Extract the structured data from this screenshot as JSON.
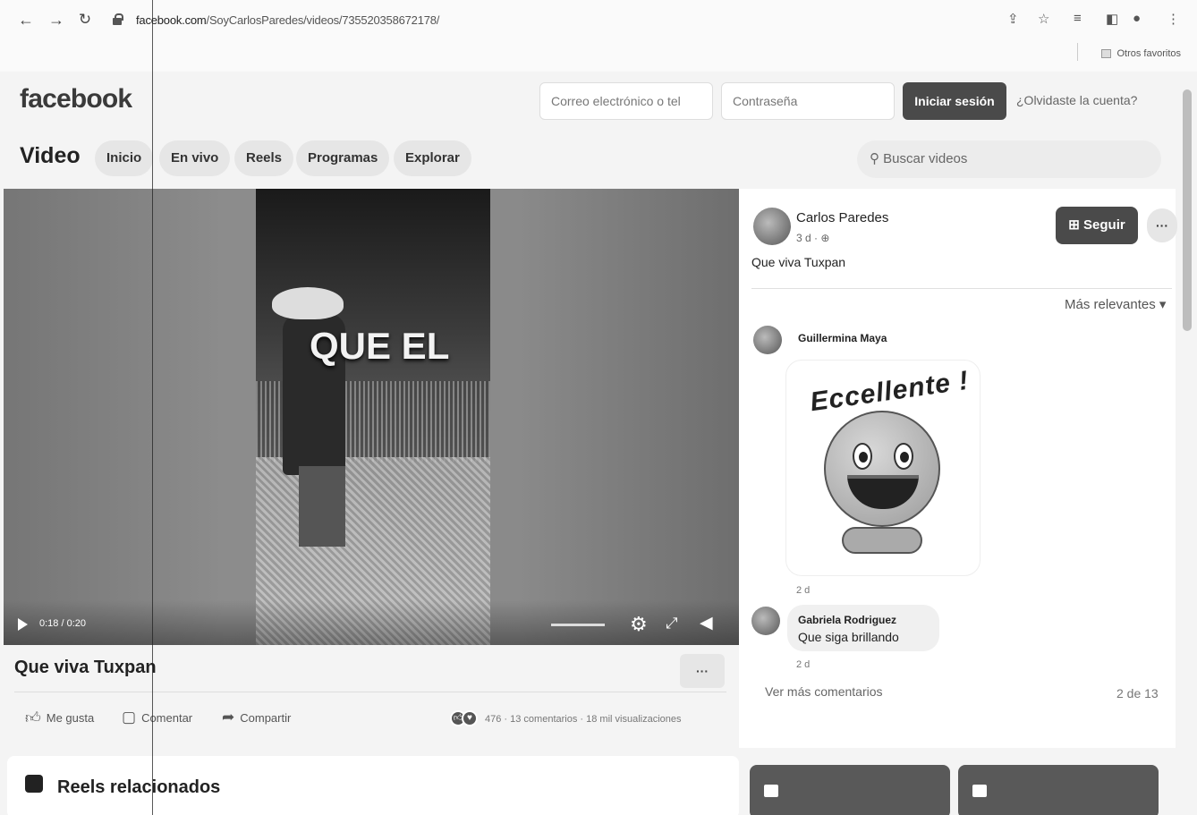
{
  "browser": {
    "url_host": "facebook.com",
    "url_path": "/SoyCarlosParedes/videos/735520358672178/",
    "bookmarks_label": "Otros favoritos"
  },
  "header": {
    "logo": "facebook",
    "email_placeholder": "Correo electrónico o tel",
    "password_placeholder": "Contraseña",
    "login_label": "Iniciar sesión",
    "forgot_label": "¿Olvidaste la cuenta?"
  },
  "video_nav": {
    "title": "Video",
    "tabs": [
      "Inicio",
      "En vivo",
      "Reels",
      "Programas",
      "Explorar"
    ],
    "search_placeholder": "Buscar videos"
  },
  "player": {
    "overlay_text": "QUE EL",
    "time": "0:18 / 0:20",
    "progress": 0.9
  },
  "post": {
    "title": "Que viva Tuxpan",
    "more_label": "···",
    "actions": [
      "Me gusta",
      "Comentar",
      "Compartir"
    ],
    "reactions": "476",
    "comments": "13 comentarios",
    "views": "18 mil visualizaciones"
  },
  "reels": {
    "title": "Reels relacionados"
  },
  "side": {
    "author": "Carlos Paredes",
    "age": "3 d ·",
    "description": "Que viva Tuxpan",
    "follow_label": "Seguir",
    "more_label": "···",
    "sort_label": "Más relevantes",
    "comments": [
      {
        "name": "Guillermina Maya",
        "sticker_text": "Eccellente !",
        "time": "2 d"
      },
      {
        "name": "Gabriela Rodriguez",
        "text": "Que siga brillando",
        "time": "2 d"
      }
    ],
    "more_comments_label": "Ver más comentarios",
    "comment_count": "2 de 13"
  },
  "colors": {
    "button_dark": "#4a4a4a",
    "background": "#f4f4f4"
  }
}
